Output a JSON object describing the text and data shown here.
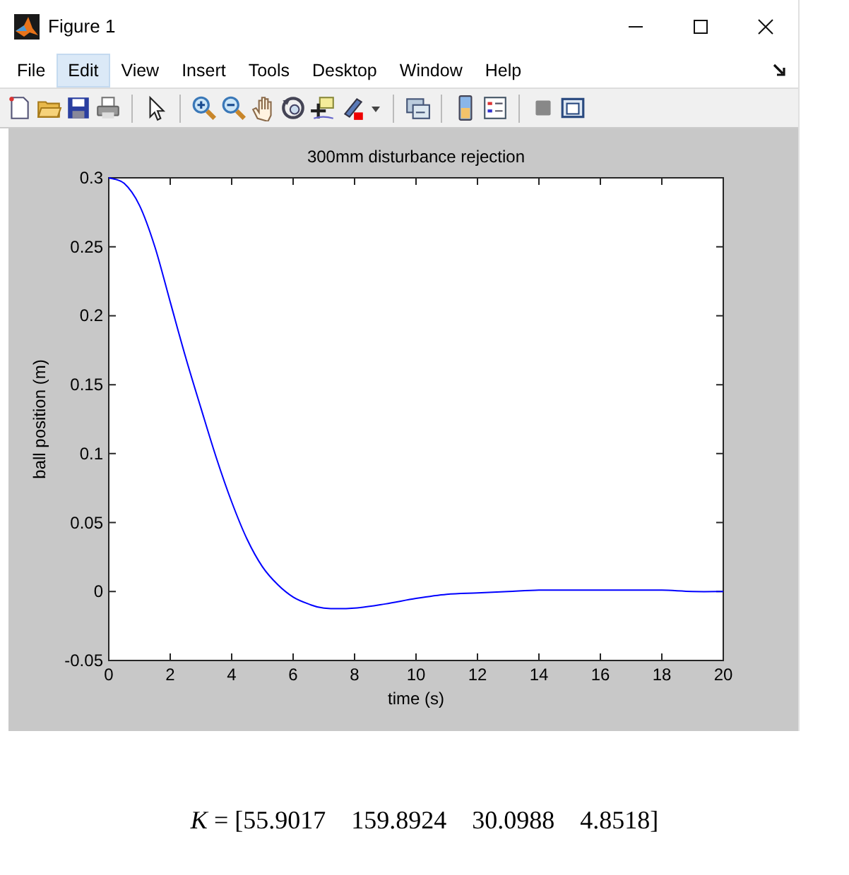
{
  "window": {
    "title": "Figure 1"
  },
  "menu": [
    {
      "label": "File",
      "selected": false
    },
    {
      "label": "Edit",
      "selected": true
    },
    {
      "label": "View",
      "selected": false
    },
    {
      "label": "Insert",
      "selected": false
    },
    {
      "label": "Tools",
      "selected": false
    },
    {
      "label": "Desktop",
      "selected": false
    },
    {
      "label": "Window",
      "selected": false
    },
    {
      "label": "Help",
      "selected": false
    }
  ],
  "figure": {
    "chart_data": {
      "type": "line",
      "title": "300mm disturbance rejection",
      "xlabel": "time (s)",
      "ylabel": "ball position (m)",
      "x": [
        0,
        0.5,
        1,
        1.5,
        2,
        2.5,
        3,
        3.5,
        4,
        4.5,
        5,
        5.5,
        6,
        6.5,
        7,
        8,
        9,
        10,
        11,
        12,
        13,
        14,
        15,
        16,
        17,
        18,
        19,
        20
      ],
      "series": [
        {
          "color": "#0000ff",
          "values": [
            0.3,
            0.296,
            0.28,
            0.25,
            0.21,
            0.17,
            0.133,
            0.097,
            0.065,
            0.038,
            0.018,
            0.005,
            -0.004,
            -0.009,
            -0.012,
            -0.012,
            -0.009,
            -0.005,
            -0.002,
            -0.001,
            0.0,
            0.001,
            0.001,
            0.001,
            0.001,
            0.001,
            0.0,
            0.0
          ]
        }
      ],
      "xlim": [
        0,
        20
      ],
      "ylim": [
        -0.05,
        0.3
      ],
      "xticks": [
        0,
        2,
        4,
        6,
        8,
        10,
        12,
        14,
        16,
        18,
        20
      ],
      "yticks": [
        {
          "value": -0.05,
          "label": "-0.05"
        },
        {
          "value": 0,
          "label": "0"
        },
        {
          "value": 0.05,
          "label": "0.05"
        },
        {
          "value": 0.1,
          "label": "0.1"
        },
        {
          "value": 0.15,
          "label": "0.15"
        },
        {
          "value": 0.2,
          "label": "0.2"
        },
        {
          "value": 0.25,
          "label": "0.25"
        },
        {
          "value": 0.3,
          "label": "0.3"
        }
      ]
    }
  },
  "equation": "*K* = [55.9017    159.8924    30.0988    4.8518]"
}
